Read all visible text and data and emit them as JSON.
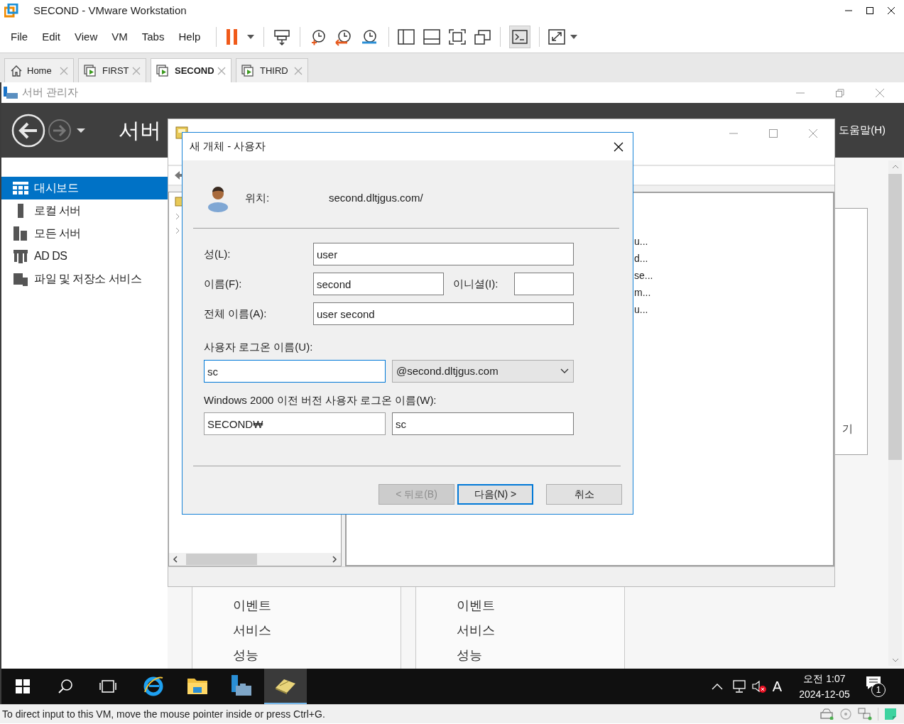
{
  "window": {
    "title": "SECOND - VMware Workstation"
  },
  "menu": [
    "File",
    "Edit",
    "View",
    "VM",
    "Tabs",
    "Help"
  ],
  "tabs": [
    {
      "label": "Home",
      "kind": "home",
      "selected": false
    },
    {
      "label": "FIRST",
      "kind": "vm",
      "selected": false
    },
    {
      "label": "SECOND",
      "kind": "vm",
      "selected": true
    },
    {
      "label": "THIRD",
      "kind": "vm",
      "selected": false
    }
  ],
  "server_manager": {
    "title": "서버 관리자",
    "header_title": "서버",
    "help_menu": "도움말(H)",
    "nav": [
      {
        "label": "대시보드",
        "kind": "dashboard",
        "selected": true
      },
      {
        "label": "로컬 서버",
        "kind": "server",
        "selected": false
      },
      {
        "label": "모든 서버",
        "kind": "servers",
        "selected": false
      },
      {
        "label": "AD DS",
        "kind": "adds",
        "selected": false
      },
      {
        "label": "파일 및 저장소 서비스",
        "kind": "files",
        "selected": false
      }
    ],
    "side_link": "기",
    "tiles": [
      {
        "items": [
          "이벤트",
          "서비스",
          "성능"
        ]
      },
      {
        "items": [
          "이벤트",
          "서비스",
          "성능"
        ]
      }
    ]
  },
  "aduc": {
    "list_items": [
      "u...",
      "d...",
      "se...",
      "m...",
      "u..."
    ]
  },
  "dialog": {
    "title": "새 개체 - 사용자",
    "location_label": "위치:",
    "location": "second.dltjgus.com/",
    "last_name": {
      "label": "성(L):",
      "value": "user"
    },
    "first_name": {
      "label": "이름(F):",
      "value": "second"
    },
    "initials": {
      "label": "이니셜(I):"
    },
    "full_name": {
      "label": "전체 이름(A):",
      "value": "user second"
    },
    "logon_label": "사용자 로그온 이름(U):",
    "logon_name": {
      "value": "sc",
      "focused": true
    },
    "upn_suffix": "@second.dltjgus.com",
    "pre2000_label": "Windows 2000 이전 버전 사용자 로그온 이름(W):",
    "domain_prefix": "SECOND₩",
    "pre2000_name": "sc",
    "buttons": [
      {
        "label": "< 뒤로(B)",
        "disabled": true,
        "default": false
      },
      {
        "label": "다음(N) >",
        "disabled": false,
        "default": true
      },
      {
        "label": "취소",
        "disabled": false,
        "default": false
      }
    ]
  },
  "taskbar": {
    "apps": [
      {
        "kind": "browser",
        "selected": false
      },
      {
        "kind": "folder",
        "selected": false
      },
      {
        "kind": "server-manager",
        "selected": false
      },
      {
        "kind": "directory",
        "selected": true
      }
    ],
    "ime": "A",
    "time": "오전 1:07",
    "date": "2024-12-05",
    "notification_count": "1"
  },
  "status_bar": "To direct input to this VM, move the mouse pointer inside or press Ctrl+G."
}
